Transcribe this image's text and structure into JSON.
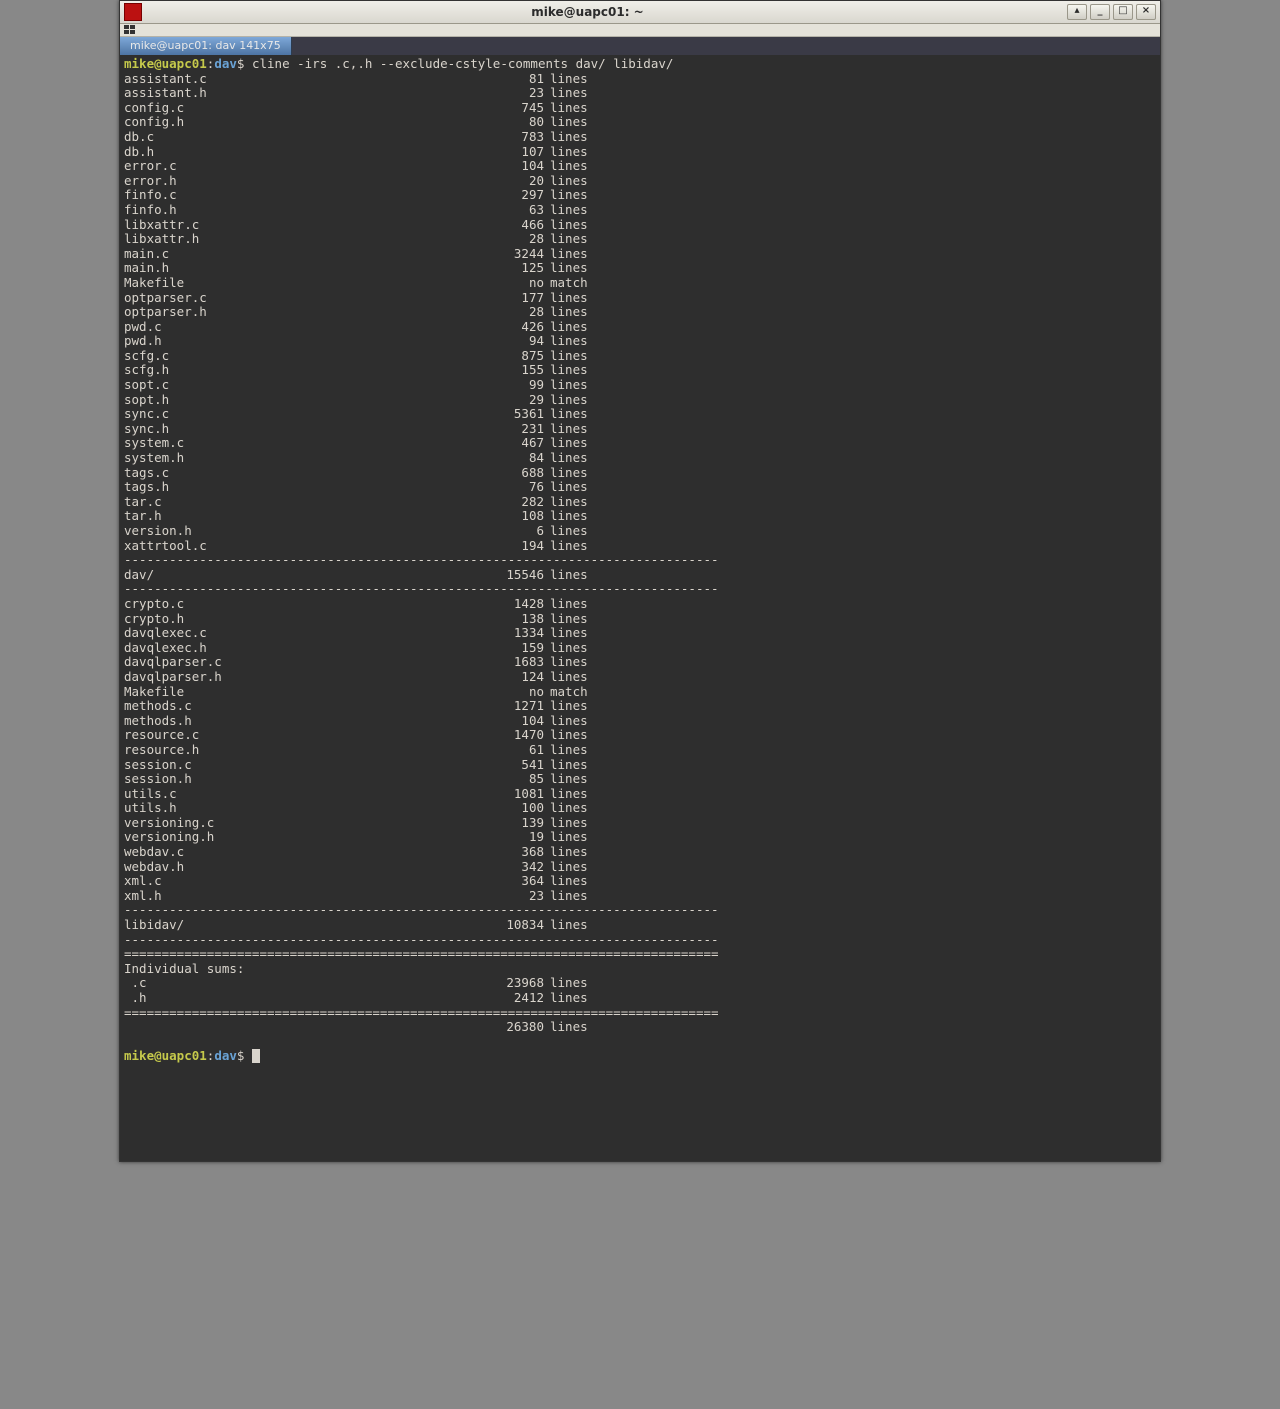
{
  "window": {
    "title": "mike@uapc01: ~",
    "controls": {
      "shade": "▴",
      "min": "_",
      "max": "□",
      "close": "×"
    }
  },
  "tab": {
    "label": "mike@uapc01: dav 141x75"
  },
  "prompt": {
    "user": "mike@uapc01",
    "sep": ":",
    "path": "dav",
    "sigil": "$ "
  },
  "command": "cline -irs .c,.h --exclude-cstyle-comments dav/ libidav/",
  "word_lines": "lines",
  "word_nomatch": "no match",
  "sections": [
    {
      "rows": [
        {
          "name": "assistant.c",
          "count": "81",
          "unit": "lines"
        },
        {
          "name": "assistant.h",
          "count": "23",
          "unit": "lines"
        },
        {
          "name": "config.c",
          "count": "745",
          "unit": "lines"
        },
        {
          "name": "config.h",
          "count": "80",
          "unit": "lines"
        },
        {
          "name": "db.c",
          "count": "783",
          "unit": "lines"
        },
        {
          "name": "db.h",
          "count": "107",
          "unit": "lines"
        },
        {
          "name": "error.c",
          "count": "104",
          "unit": "lines"
        },
        {
          "name": "error.h",
          "count": "20",
          "unit": "lines"
        },
        {
          "name": "finfo.c",
          "count": "297",
          "unit": "lines"
        },
        {
          "name": "finfo.h",
          "count": "63",
          "unit": "lines"
        },
        {
          "name": "libxattr.c",
          "count": "466",
          "unit": "lines"
        },
        {
          "name": "libxattr.h",
          "count": "28",
          "unit": "lines"
        },
        {
          "name": "main.c",
          "count": "3244",
          "unit": "lines"
        },
        {
          "name": "main.h",
          "count": "125",
          "unit": "lines"
        },
        {
          "name": "Makefile",
          "count": "no",
          "unit": "match"
        },
        {
          "name": "optparser.c",
          "count": "177",
          "unit": "lines"
        },
        {
          "name": "optparser.h",
          "count": "28",
          "unit": "lines"
        },
        {
          "name": "pwd.c",
          "count": "426",
          "unit": "lines"
        },
        {
          "name": "pwd.h",
          "count": "94",
          "unit": "lines"
        },
        {
          "name": "scfg.c",
          "count": "875",
          "unit": "lines"
        },
        {
          "name": "scfg.h",
          "count": "155",
          "unit": "lines"
        },
        {
          "name": "sopt.c",
          "count": "99",
          "unit": "lines"
        },
        {
          "name": "sopt.h",
          "count": "29",
          "unit": "lines"
        },
        {
          "name": "sync.c",
          "count": "5361",
          "unit": "lines"
        },
        {
          "name": "sync.h",
          "count": "231",
          "unit": "lines"
        },
        {
          "name": "system.c",
          "count": "467",
          "unit": "lines"
        },
        {
          "name": "system.h",
          "count": "84",
          "unit": "lines"
        },
        {
          "name": "tags.c",
          "count": "688",
          "unit": "lines"
        },
        {
          "name": "tags.h",
          "count": "76",
          "unit": "lines"
        },
        {
          "name": "tar.c",
          "count": "282",
          "unit": "lines"
        },
        {
          "name": "tar.h",
          "count": "108",
          "unit": "lines"
        },
        {
          "name": "version.h",
          "count": "6",
          "unit": "lines"
        },
        {
          "name": "xattrtool.c",
          "count": "194",
          "unit": "lines"
        }
      ],
      "total": {
        "name": "dav/",
        "count": "15546",
        "unit": "lines"
      }
    },
    {
      "rows": [
        {
          "name": "crypto.c",
          "count": "1428",
          "unit": "lines"
        },
        {
          "name": "crypto.h",
          "count": "138",
          "unit": "lines"
        },
        {
          "name": "davqlexec.c",
          "count": "1334",
          "unit": "lines"
        },
        {
          "name": "davqlexec.h",
          "count": "159",
          "unit": "lines"
        },
        {
          "name": "davqlparser.c",
          "count": "1683",
          "unit": "lines"
        },
        {
          "name": "davqlparser.h",
          "count": "124",
          "unit": "lines"
        },
        {
          "name": "Makefile",
          "count": "no",
          "unit": "match"
        },
        {
          "name": "methods.c",
          "count": "1271",
          "unit": "lines"
        },
        {
          "name": "methods.h",
          "count": "104",
          "unit": "lines"
        },
        {
          "name": "resource.c",
          "count": "1470",
          "unit": "lines"
        },
        {
          "name": "resource.h",
          "count": "61",
          "unit": "lines"
        },
        {
          "name": "session.c",
          "count": "541",
          "unit": "lines"
        },
        {
          "name": "session.h",
          "count": "85",
          "unit": "lines"
        },
        {
          "name": "utils.c",
          "count": "1081",
          "unit": "lines"
        },
        {
          "name": "utils.h",
          "count": "100",
          "unit": "lines"
        },
        {
          "name": "versioning.c",
          "count": "139",
          "unit": "lines"
        },
        {
          "name": "versioning.h",
          "count": "19",
          "unit": "lines"
        },
        {
          "name": "webdav.c",
          "count": "368",
          "unit": "lines"
        },
        {
          "name": "webdav.h",
          "count": "342",
          "unit": "lines"
        },
        {
          "name": "xml.c",
          "count": "364",
          "unit": "lines"
        },
        {
          "name": "xml.h",
          "count": "23",
          "unit": "lines"
        }
      ],
      "total": {
        "name": "libidav/",
        "count": "10834",
        "unit": "lines"
      }
    }
  ],
  "indiv_heading": "Individual sums:",
  "indiv_rows": [
    {
      "name": " .c",
      "count": "23968",
      "unit": "lines"
    },
    {
      "name": " .h",
      "count": "2412",
      "unit": "lines"
    }
  ],
  "grand_total": {
    "name": "",
    "count": "26380",
    "unit": "lines"
  },
  "rules": {
    "dash": "-------------------------------------------------------------------------------",
    "eq": "==============================================================================="
  }
}
